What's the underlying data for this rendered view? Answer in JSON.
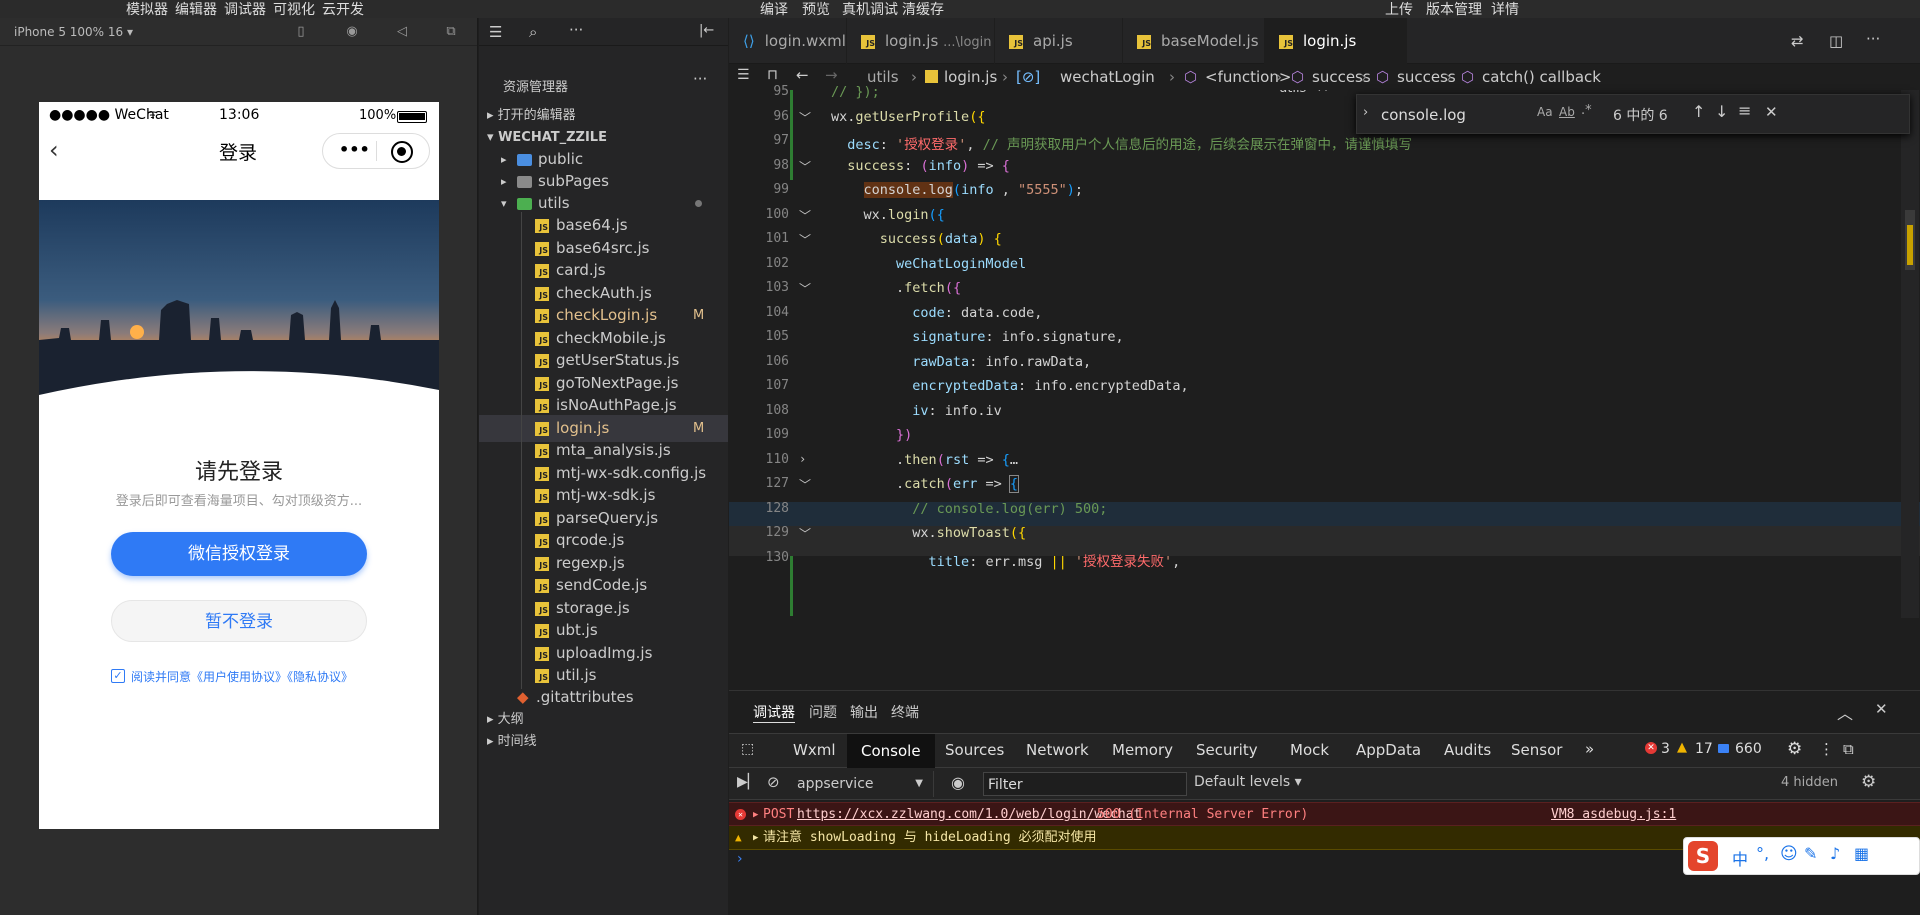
{
  "topbar": {
    "left_menu": [
      "模拟器",
      "编辑器",
      "调试器",
      "可视化",
      "云开发"
    ],
    "center_menu": [
      "编译",
      "预览",
      "真机调试",
      "清缓存"
    ],
    "right_menu": [
      "上传",
      "版本管理",
      "详情"
    ]
  },
  "simulator": {
    "device_label": "iPhone 5 100% 16 ▾",
    "status": {
      "carrier": "●●●●● WeChat",
      "time": "13:06",
      "battery": "100%"
    },
    "nav_title": "登录",
    "headline": "请先登录",
    "subtitle": "登录后即可查看海量项目、勾对顶级资方...",
    "primary_button": "微信授权登录",
    "secondary_button": "暂不登录",
    "agreement": "阅读并同意《用户使用协议》《隐私协议》"
  },
  "explorer": {
    "title": "资源管理器",
    "open_editors": "打开的编辑器",
    "project": "WECHAT_ZZILE",
    "folders": [
      "public",
      "subPages",
      "utils"
    ],
    "files": [
      {
        "name": "base64.js",
        "badge": ""
      },
      {
        "name": "base64src.js",
        "badge": ""
      },
      {
        "name": "card.js",
        "badge": ""
      },
      {
        "name": "checkAuth.js",
        "badge": ""
      },
      {
        "name": "checkLogin.js",
        "badge": "M"
      },
      {
        "name": "checkMobile.js",
        "badge": ""
      },
      {
        "name": "getUserStatus.js",
        "badge": ""
      },
      {
        "name": "goToNextPage.js",
        "badge": ""
      },
      {
        "name": "isNoAuthPage.js",
        "badge": ""
      },
      {
        "name": "login.js",
        "badge": "M"
      },
      {
        "name": "mta_analysis.js",
        "badge": ""
      },
      {
        "name": "mtj-wx-sdk.config.js",
        "badge": ""
      },
      {
        "name": "mtj-wx-sdk.js",
        "badge": ""
      },
      {
        "name": "parseQuery.js",
        "badge": ""
      },
      {
        "name": "qrcode.js",
        "badge": ""
      },
      {
        "name": "regexp.js",
        "badge": ""
      },
      {
        "name": "sendCode.js",
        "badge": ""
      },
      {
        "name": "storage.js",
        "badge": ""
      },
      {
        "name": "ubt.js",
        "badge": ""
      },
      {
        "name": "uploadImg.js",
        "badge": ""
      },
      {
        "name": "util.js",
        "badge": ""
      }
    ],
    "gitattributes": ".gitattributes",
    "outline": "大纲",
    "timeline": "时间线"
  },
  "editor": {
    "tabs": [
      {
        "label": "login.wxml",
        "hint": ""
      },
      {
        "label": "login.js",
        "hint": "...\\login"
      },
      {
        "label": "api.js",
        "hint": ""
      },
      {
        "label": "baseModel.js",
        "hint": ""
      },
      {
        "label": "login.js",
        "hint": "utils"
      }
    ],
    "breadcrumbs": [
      "utils",
      "login.js",
      "wechatLogin",
      "<function>",
      "success",
      "success",
      "catch() callback"
    ],
    "find": {
      "query": "console.log",
      "result": "6 中的 6"
    },
    "line_numbers": [
      "95",
      "96",
      "97",
      "98",
      "99",
      "100",
      "101",
      "102",
      "103",
      "104",
      "105",
      "106",
      "107",
      "108",
      "109",
      "110",
      "127",
      "128",
      "129",
      "130"
    ]
  },
  "devtools": {
    "panel_tabs": [
      "调试器",
      "问题",
      "输出",
      "终端"
    ],
    "tabs": [
      "Wxml",
      "Console",
      "Sources",
      "Network",
      "Memory",
      "Security",
      "Mock",
      "AppData",
      "Audits",
      "Sensor"
    ],
    "counts": {
      "errors": "3",
      "warnings": "17",
      "messages": "660"
    },
    "context": "appservice",
    "filter_placeholder": "Filter",
    "levels": "Default levels ▾",
    "hidden": "4 hidden",
    "log": [
      {
        "prefix": "POST",
        "url": "https://xcx.zzlwang.com/1.0/web/login/wechat",
        "status": "500 (Internal Server Error)",
        "source": "VM8 asdebug.js:1"
      },
      {
        "text": "请注意 showLoading 与 hideLoading 必须配对使用"
      }
    ]
  }
}
